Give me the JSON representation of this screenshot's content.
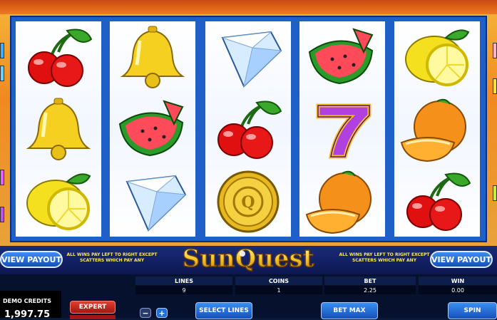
{
  "reels": [
    [
      "cherry",
      "bell",
      "lemon"
    ],
    [
      "bell",
      "watermelon",
      "diamond"
    ],
    [
      "diamond",
      "cherry",
      "sun-coin"
    ],
    [
      "watermelon",
      "seven",
      "orange"
    ],
    [
      "lemon",
      "orange",
      "cherry"
    ]
  ],
  "banner": {
    "left_button": "VIEW PAYOUT",
    "right_button": "VIEW PAYOUT",
    "note_left": "ALL WINS PAY LEFT TO RIGHT EXCEPT SCATTERS WHICH PAY ANY",
    "note_right": "ALL WINS PAY LEFT TO RIGHT EXCEPT SCATTERS WHICH PAY ANY",
    "logo": "SunQuest"
  },
  "stats": {
    "lines_label": "LINES",
    "lines_value": "9",
    "coins_label": "COINS",
    "coins_value": "1",
    "bet_label": "BET",
    "bet_value": "2.25",
    "win_label": "WIN",
    "win_value": "0.00"
  },
  "credits": {
    "label": "DEMO CREDITS",
    "value": "1,997.75"
  },
  "controls": {
    "expert": "EXPERT",
    "minus": "−",
    "plus": "+",
    "select_lines": "SELECT LINES",
    "bet_max": "BET MAX",
    "spin": "SPIN"
  },
  "colors": {
    "reel_frame": "#1e5fc8",
    "button_blue": "#1f6fd8",
    "expert_red": "#c0241c",
    "logo_gold": "#f5c82a"
  }
}
